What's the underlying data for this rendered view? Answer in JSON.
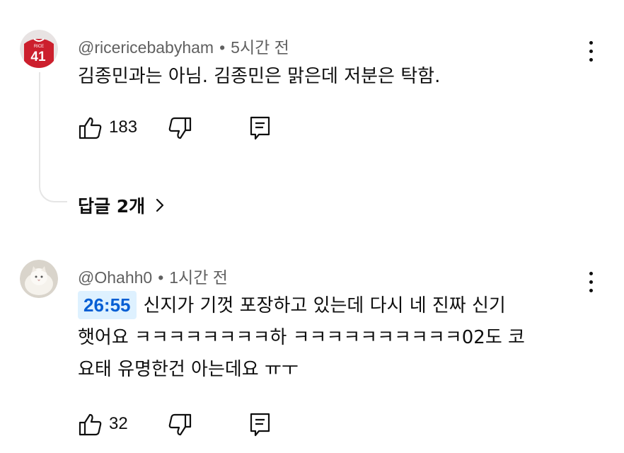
{
  "comments": [
    {
      "author": "@ricericebabyham",
      "separator": "•",
      "time": "5시간 전",
      "text": "김종민과는 아님. 김종민은 맑은데 저분은 탁함.",
      "likes": "183",
      "avatar": {
        "jersey_text": "RICE",
        "jersey_number": "41",
        "color": "#cc1f2d"
      },
      "replies_label": "답글 2개"
    },
    {
      "author": "@Ohahh0",
      "separator": "•",
      "time": "1시간 전",
      "timestamp_link": "26:55",
      "lines": [
        "신지가 기껏 포장하고 있는데 다시 네 진짜 신기",
        "햇어요 ㅋㅋㅋㅋㅋㅋㅋㅋ하 ㅋㅋㅋㅋㅋㅋㅋㅋㅋㅋ02도 코",
        "요태 유명한건 아는데요 ㅠㅜ"
      ],
      "likes": "32"
    }
  ],
  "icons": {
    "like": "thumbs-up-icon",
    "dislike": "thumbs-down-icon",
    "reply": "reply-icon",
    "more": "more-vertical-icon",
    "expand": "chevron-right-icon"
  },
  "colors": {
    "link": "#065fd4",
    "timestamp_bg": "#def1ff",
    "meta": "#606060"
  }
}
